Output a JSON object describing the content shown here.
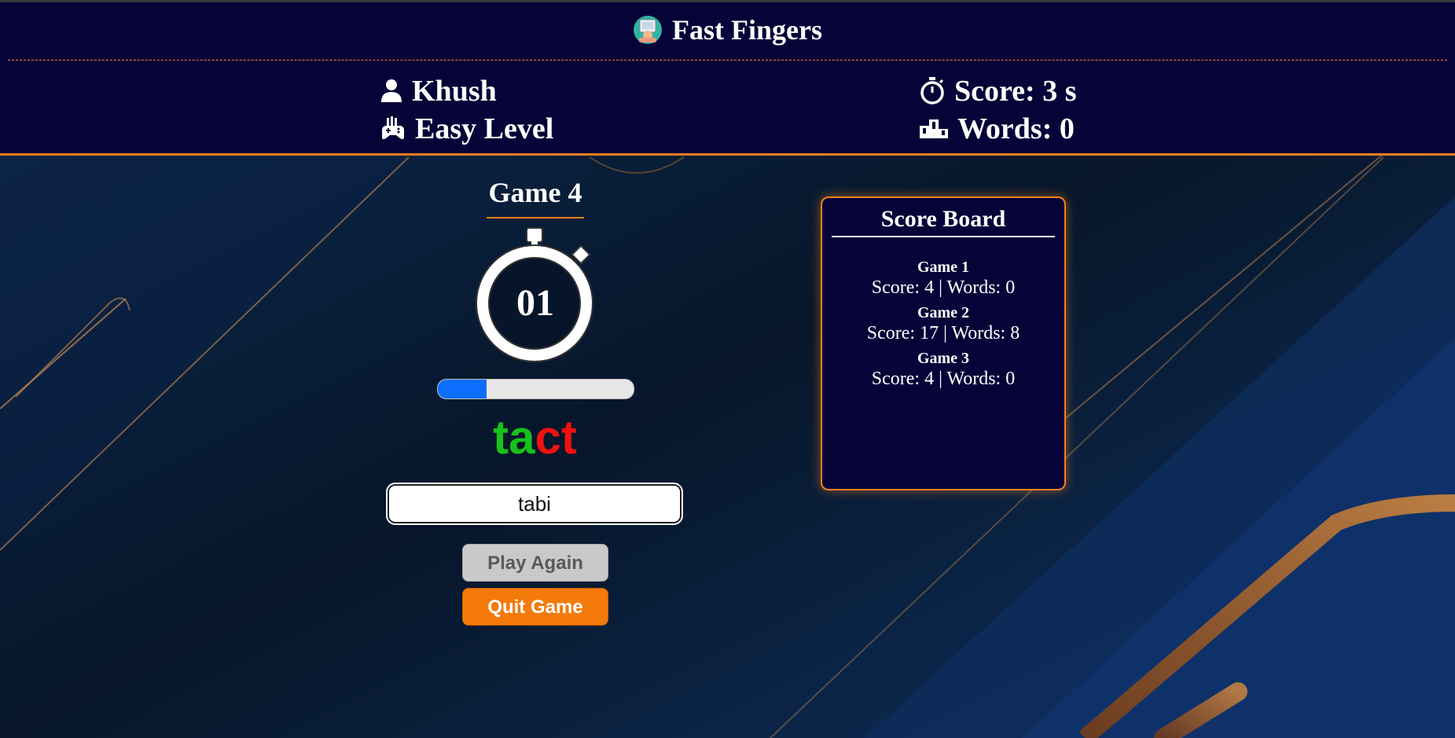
{
  "app": {
    "title": "Fast Fingers"
  },
  "player": {
    "name": "Khush",
    "level": "Easy Level"
  },
  "stats": {
    "score": "Score: 3 s",
    "words": "Words: 0"
  },
  "game": {
    "title": "Game 4",
    "timer": "01",
    "progress": 0.25,
    "word_correct": "ta",
    "word_wrong": "ct",
    "input_value": "tabi"
  },
  "buttons": {
    "play_again": "Play Again",
    "quit": "Quit Game"
  },
  "scoreboard": {
    "title": "Score Board",
    "entries": [
      {
        "name": "Game 1",
        "stat": "Score: 4 | Words: 0"
      },
      {
        "name": "Game 2",
        "stat": "Score: 17 | Words: 8"
      },
      {
        "name": "Game 3",
        "stat": "Score: 4 | Words: 0"
      }
    ]
  },
  "colors": {
    "header_bg": "#060338",
    "accent": "#f0801e",
    "correct": "#17c21a",
    "wrong": "#f01010",
    "progress": "#0d6efd"
  },
  "icons": [
    "typing-person-logo",
    "user-icon",
    "gamepad-icon",
    "stopwatch-icon",
    "podium-icon"
  ]
}
